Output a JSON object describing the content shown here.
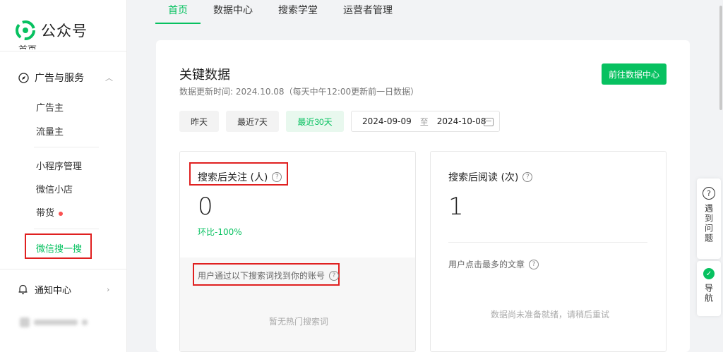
{
  "brand": {
    "name": "公众号",
    "accent": "#07c160"
  },
  "sidebar": {
    "cut_item": "首页",
    "group": {
      "label": "广告与服务"
    },
    "items": [
      {
        "label": "广告主"
      },
      {
        "label": "流量主"
      },
      {
        "label": "小程序管理"
      },
      {
        "label": "微信小店"
      },
      {
        "label": "带货"
      },
      {
        "label": "微信搜一搜"
      }
    ],
    "notice": "通知中心"
  },
  "topnav": {
    "tabs": [
      "首页",
      "数据中心",
      "搜索学堂",
      "运营者管理"
    ],
    "active": 0
  },
  "main": {
    "title": "关键数据",
    "update_time": "数据更新时间: 2024.10.08（每天中午12:00更新前一日数据）",
    "cta": "前往数据中心",
    "ranges": [
      "昨天",
      "最近7天",
      "最近30天"
    ],
    "date_start": "2024-09-09",
    "date_to": "至",
    "date_end": "2024-10-08"
  },
  "panels": {
    "left": {
      "title": "搜索后关注 (人)",
      "value": "0",
      "delta": "环比-100%",
      "foot_label": "用户通过以下搜索词找到你的账号",
      "empty": "暂无热门搜索词"
    },
    "right": {
      "title": "搜索后阅读 (次)",
      "value": "1",
      "foot_label": "用户点击最多的文章",
      "empty": "数据尚未准备就绪，请稍后重试"
    }
  },
  "float": {
    "help": "遇到问题",
    "nav": "导航"
  }
}
